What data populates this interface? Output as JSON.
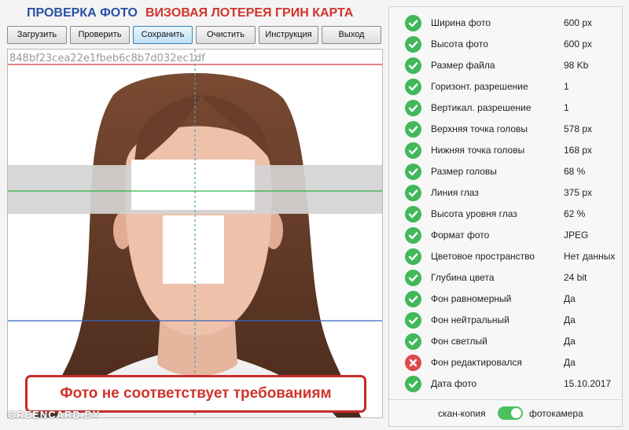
{
  "header": {
    "title_left": "ПРОВЕРКА ФОТО",
    "title_right": "ВИЗОВАЯ ЛОТЕРЕЯ ГРИН КАРТА"
  },
  "toolbar": {
    "buttons": [
      {
        "label": "Загрузить"
      },
      {
        "label": "Проверить"
      },
      {
        "label": "Сохранить",
        "active": true
      },
      {
        "label": "Очистить"
      },
      {
        "label": "Инструкция"
      },
      {
        "label": "Выход"
      }
    ]
  },
  "photo": {
    "hash": "848bf23cea22e1fbeb6c8b7d032ec1df",
    "alert": "Фото не соответствует требованиям",
    "watermark": "GREENCARD.BY"
  },
  "checks": [
    {
      "label": "Ширина фото",
      "value": "600 px",
      "status": "ok"
    },
    {
      "label": "Высота фото",
      "value": "600 px",
      "status": "ok"
    },
    {
      "label": "Размер файла",
      "value": "98 Kb",
      "status": "ok"
    },
    {
      "label": "Горизонт. разрешение",
      "value": "1",
      "status": "ok"
    },
    {
      "label": "Вертикал. разрешение",
      "value": "1",
      "status": "ok"
    },
    {
      "label": "Верхняя точка головы",
      "value": "578 px",
      "status": "ok"
    },
    {
      "label": "Нижняя точка головы",
      "value": "168 px",
      "status": "ok"
    },
    {
      "label": "Размер головы",
      "value": "68 %",
      "status": "ok"
    },
    {
      "label": "Линия глаз",
      "value": "375 px",
      "status": "ok"
    },
    {
      "label": "Высота уровня глаз",
      "value": "62 %",
      "status": "ok"
    },
    {
      "label": "Формат фото",
      "value": "JPEG",
      "status": "ok"
    },
    {
      "label": "Цветовое пространство",
      "value": "Нет данных",
      "status": "ok"
    },
    {
      "label": "Глубина цвета",
      "value": "24 bit",
      "status": "ok"
    },
    {
      "label": "Фон равномерный",
      "value": "Да",
      "status": "ok"
    },
    {
      "label": "Фон нейтральный",
      "value": "Да",
      "status": "ok"
    },
    {
      "label": "Фон светлый",
      "value": "Да",
      "status": "ok"
    },
    {
      "label": "Фон редактировался",
      "value": "Да",
      "status": "fail"
    },
    {
      "label": "Дата фото",
      "value": "15.10.2017",
      "status": "ok"
    }
  ],
  "mode_toggle": {
    "left_label": "скан-копия",
    "right_label": "фотокамера",
    "selected": "фотокамера"
  },
  "colors": {
    "ok": "#41b85a",
    "fail": "#df4a4a",
    "title_blue": "#2750a6",
    "title_red": "#d0342c"
  }
}
